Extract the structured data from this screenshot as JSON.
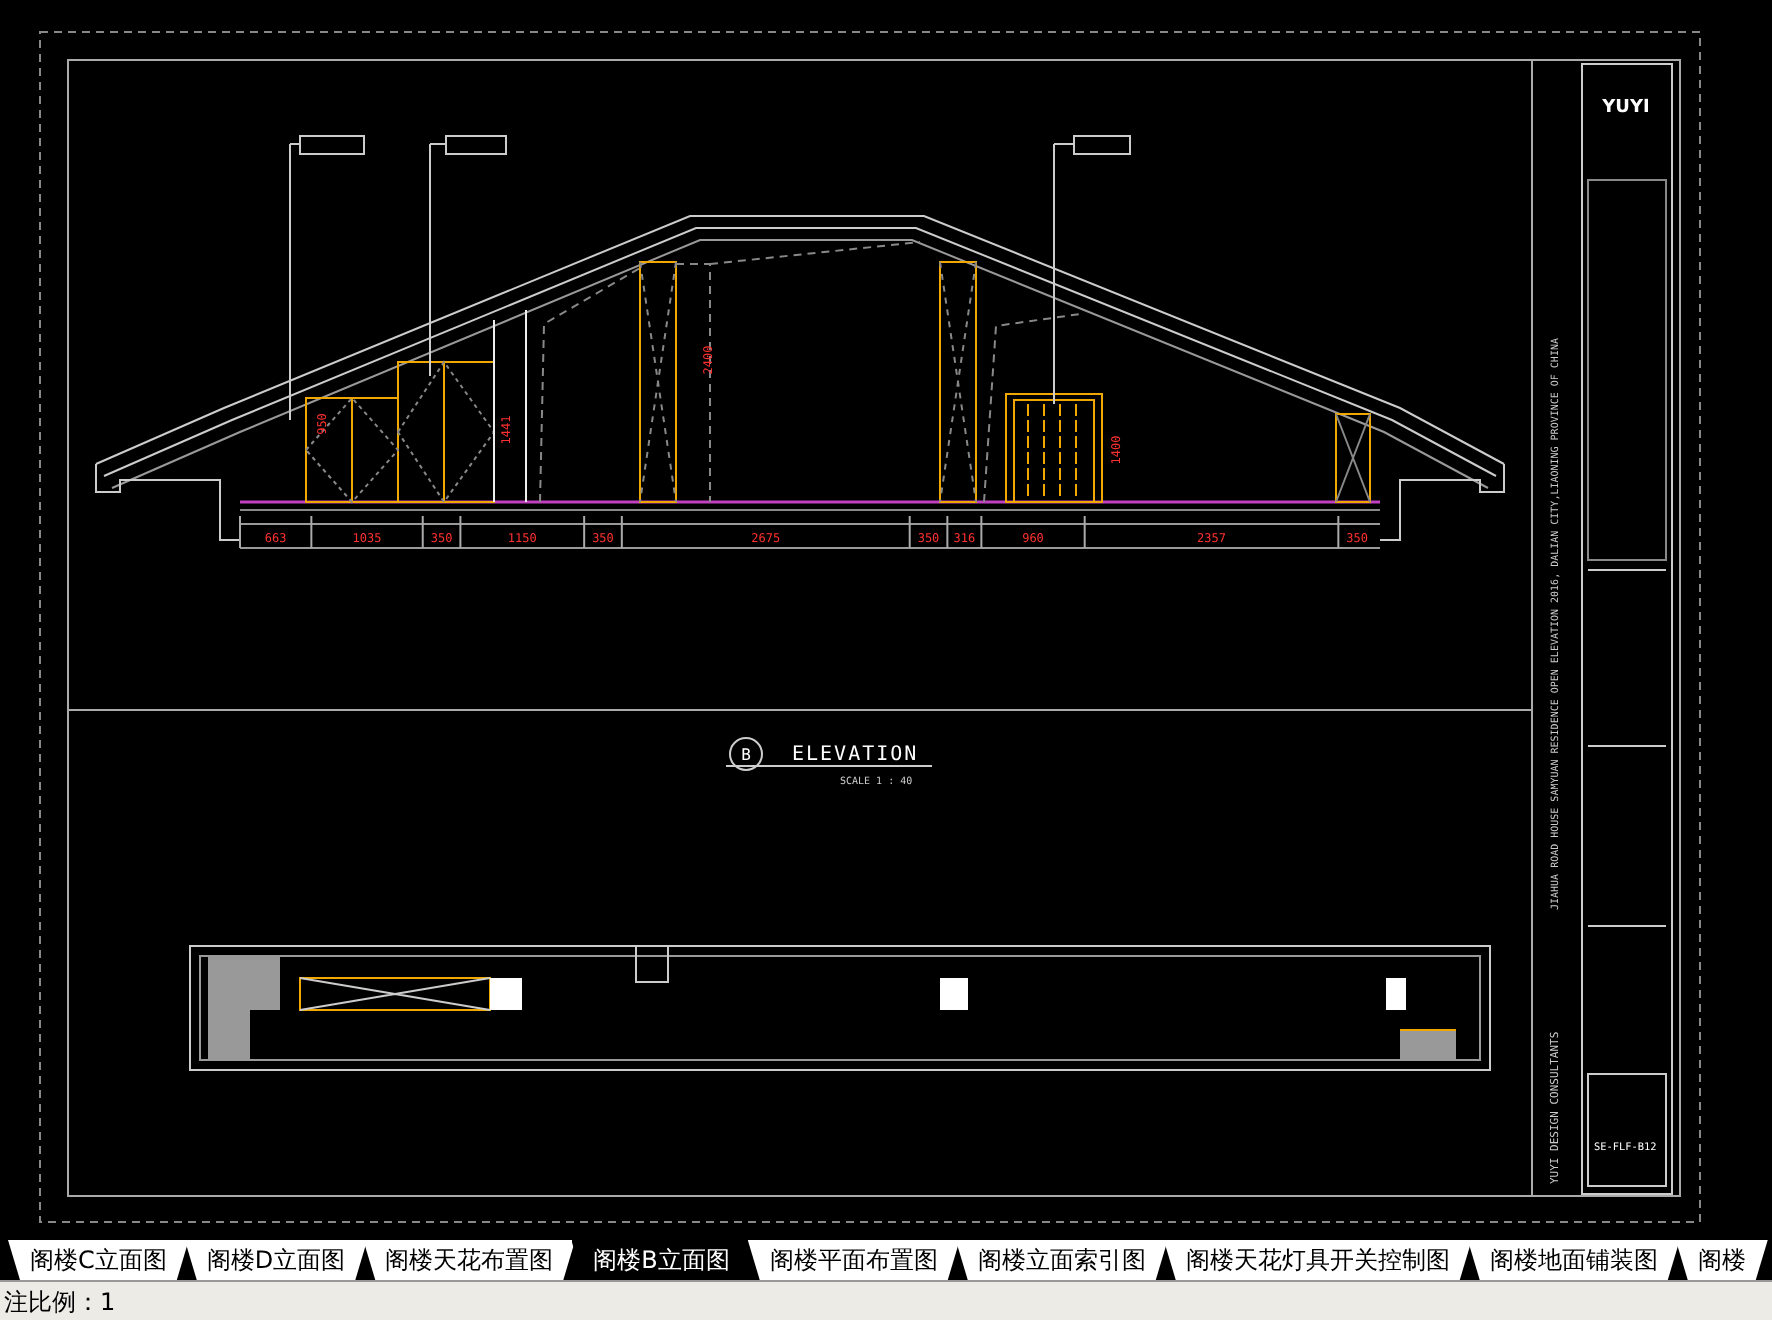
{
  "drawing": {
    "elevation_dimensions": [
      "663",
      "1035",
      "350",
      "1150",
      "350",
      "2675",
      "350",
      "316",
      "960",
      "2357",
      "350"
    ],
    "height_dimensions": [
      "950",
      "1441",
      "2400",
      "1400"
    ],
    "view": {
      "marker": "B",
      "title": "ELEVATION",
      "scale": "SCALE 1 : 40"
    }
  },
  "title_block": {
    "logo": "YUYI",
    "project_note": "JIAHUA ROAD HOUSE SAMYUAN RESIDENCE OPEN ELEVATION 2016, DALIAN CITY,LIAONING PROVINCE OF CHINA",
    "company": "YUYI DESIGN CONSULTANTS",
    "drawing_number": "SE-FLF-B12"
  },
  "tabs": [
    {
      "label": "阁楼C立面图",
      "selected": false
    },
    {
      "label": "阁楼D立面图",
      "selected": false
    },
    {
      "label": "阁楼天花布置图",
      "selected": false
    },
    {
      "label": "阁楼B立面图",
      "selected": true
    },
    {
      "label": "阁楼平面布置图",
      "selected": false
    },
    {
      "label": "阁楼立面索引图",
      "selected": false
    },
    {
      "label": "阁楼天花灯具开关控制图",
      "selected": false
    },
    {
      "label": "阁楼地面铺装图",
      "selected": false
    },
    {
      "label": "阁楼",
      "selected": false
    }
  ],
  "status_bar": {
    "text": "注比例：1"
  }
}
